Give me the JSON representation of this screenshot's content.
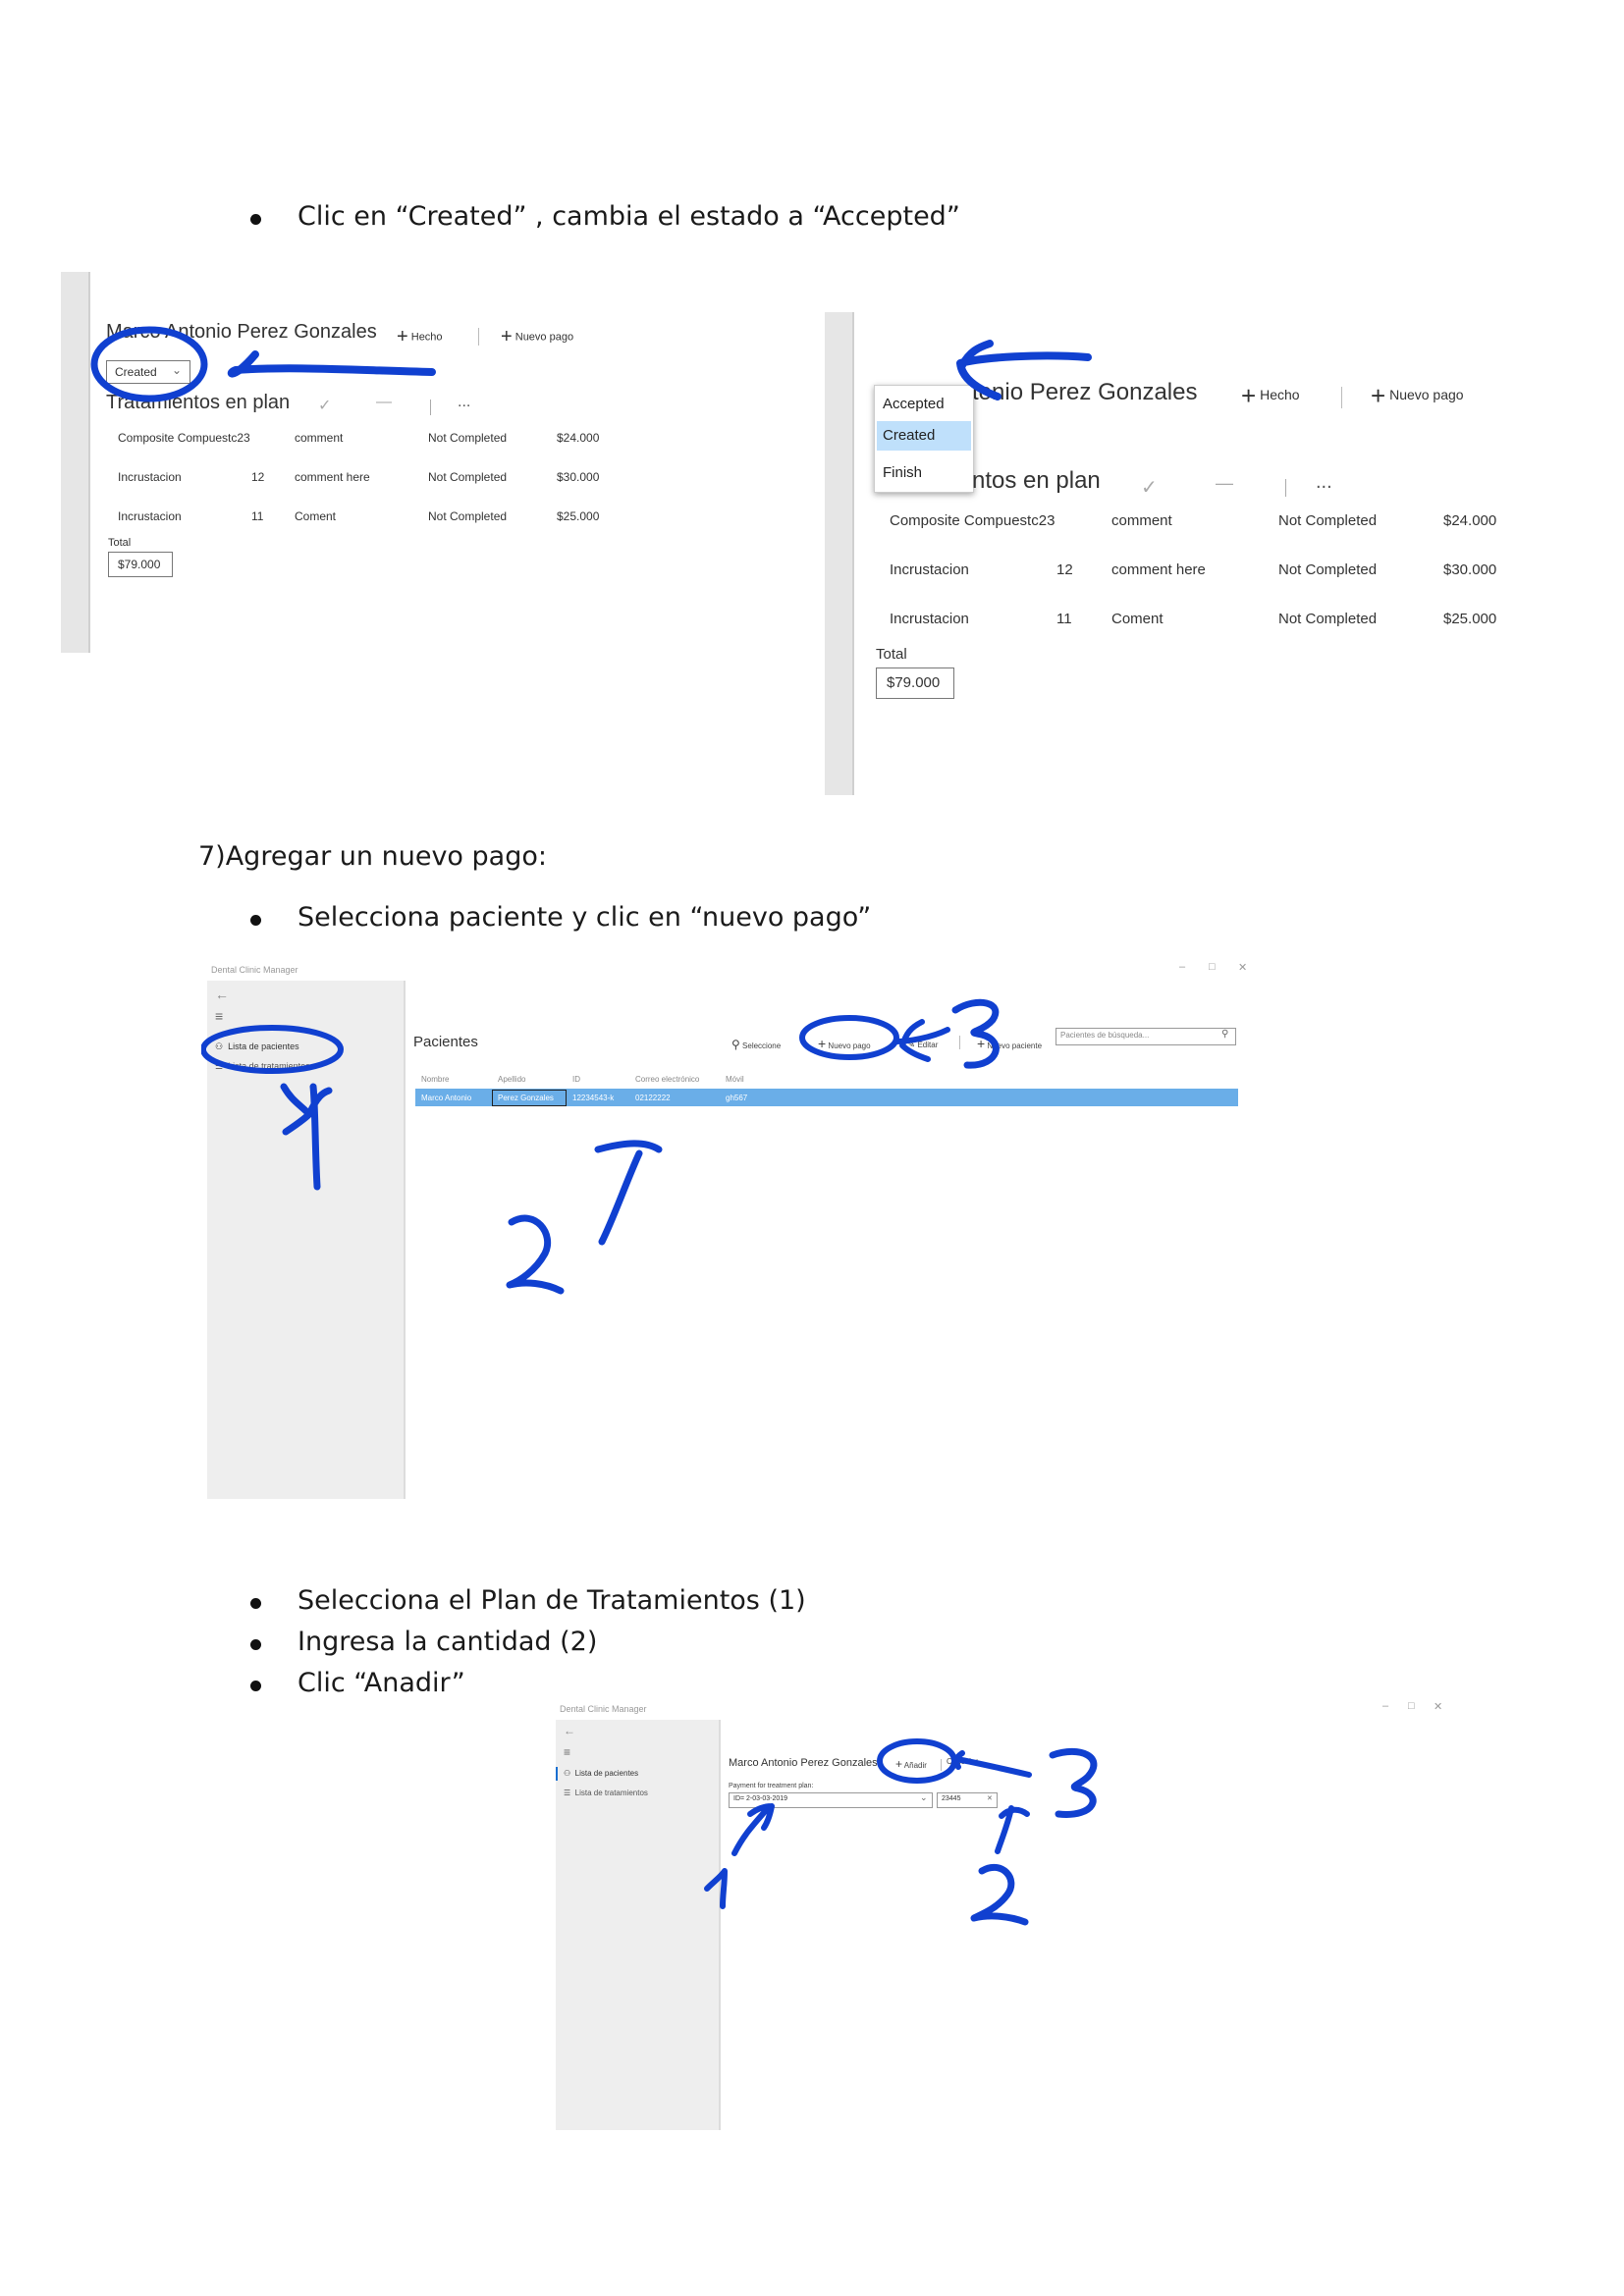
{
  "steps": {
    "created_bullet": "Clic en “Created” , cambia el estado a “Accepted”",
    "section7_title": "7)Agregar un nuevo pago:",
    "select_patient_bullet": "Selecciona paciente y clic en “nuevo pago”",
    "select_plan_bullet": "Selecciona el Plan de Tratamientos (1)",
    "enter_amount_bullet": "Ingresa la cantidad (2)",
    "click_add_bullet": "Clic “Anadir”"
  },
  "plan_screen": {
    "patient_name": "Marco Antonio Perez Gonzales",
    "hecho_label": "Hecho",
    "nuevo_pago_label": "Nuevo pago",
    "status_value": "Created",
    "section_title": "Tratamientos en plan",
    "section_title_partial": "ntos en plan",
    "name_partial": "tonio Perez Gonzales",
    "more_label": "...",
    "rows": [
      {
        "name": "Composite Compuestc23",
        "qty": "",
        "comment": "comment",
        "status": "Not Completed",
        "price": "$24.000"
      },
      {
        "name": "Incrustacion",
        "qty": "12",
        "comment": "comment here",
        "status": "Not Completed",
        "price": "$30.000"
      },
      {
        "name": "Incrustacion",
        "qty": "11",
        "comment": "Coment",
        "status": "Not Completed",
        "price": "$25.000"
      }
    ],
    "total_label": "Total",
    "total_value": "$79.000",
    "status_options": [
      "Accepted",
      "Created",
      "Finish"
    ]
  },
  "patients_screen": {
    "app_title": "Dental Clinic Manager",
    "nav_patients": "Lista de pacientes",
    "nav_treatments": "Lista de tratamientos",
    "page_title": "Pacientes",
    "toolbar": {
      "select": "Seleccione",
      "new_payment": "Nuevo pago",
      "edit": "Editar",
      "new_patient": "Nuevo paciente",
      "search_placeholder": "Pacientes de búsqueda..."
    },
    "columns": [
      "Nombre",
      "Apellido",
      "ID",
      "Correo electrónico",
      "Móvil"
    ],
    "rows": [
      [
        "Marco Antonio",
        "Perez Gonzales",
        "12234543-k",
        "02122222",
        "gh567"
      ]
    ]
  },
  "payment_screen": {
    "app_title": "Dental Clinic Manager",
    "nav_patients": "Lista de pacientes",
    "nav_treatments": "Lista de tratamientos",
    "patient_name": "Marco Antonio Perez Gonzales",
    "add_label": "Añadir",
    "cancel_label": "Cancelar",
    "plan_label": "Payment for treatment plan:",
    "plan_value": "ID= 2-03-03-2019",
    "amount_value": "23445"
  },
  "colors": {
    "annotation": "#1040d0",
    "selection": "#6aaee8",
    "dropdown_selected": "#bfe0fb"
  }
}
